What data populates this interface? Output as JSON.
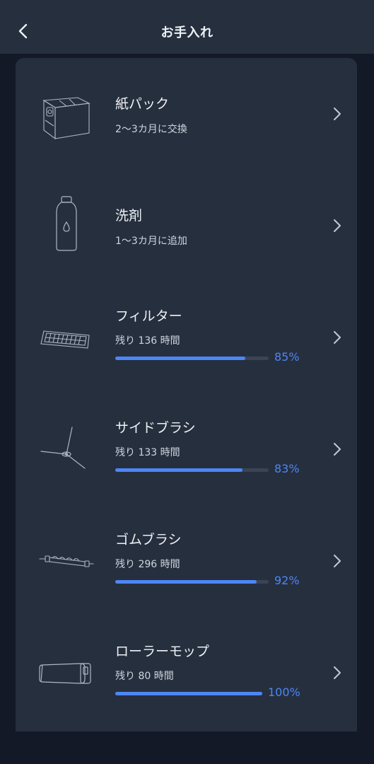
{
  "header": {
    "title": "お手入れ"
  },
  "colors": {
    "accent": "#4d86f5",
    "card": "#262f3e",
    "background": "#131926"
  },
  "items": [
    {
      "icon": "paper-bag-icon",
      "title": "紙パック",
      "subtitle": "2～3カ月に交換"
    },
    {
      "icon": "detergent-bottle-icon",
      "title": "洗剤",
      "subtitle": "1～3カ月に追加"
    },
    {
      "icon": "filter-icon",
      "title": "フィルター",
      "subtitle": "残り 136 時間",
      "progress": 85,
      "progress_label": "85%"
    },
    {
      "icon": "side-brush-icon",
      "title": "サイドブラシ",
      "subtitle": "残り 133 時間",
      "progress": 83,
      "progress_label": "83%"
    },
    {
      "icon": "rubber-brush-icon",
      "title": "ゴムブラシ",
      "subtitle": "残り 296 時間",
      "progress": 92,
      "progress_label": "92%"
    },
    {
      "icon": "roller-mop-icon",
      "title": "ローラーモップ",
      "subtitle": "残り 80 時間",
      "progress": 100,
      "progress_label": "100%"
    }
  ]
}
